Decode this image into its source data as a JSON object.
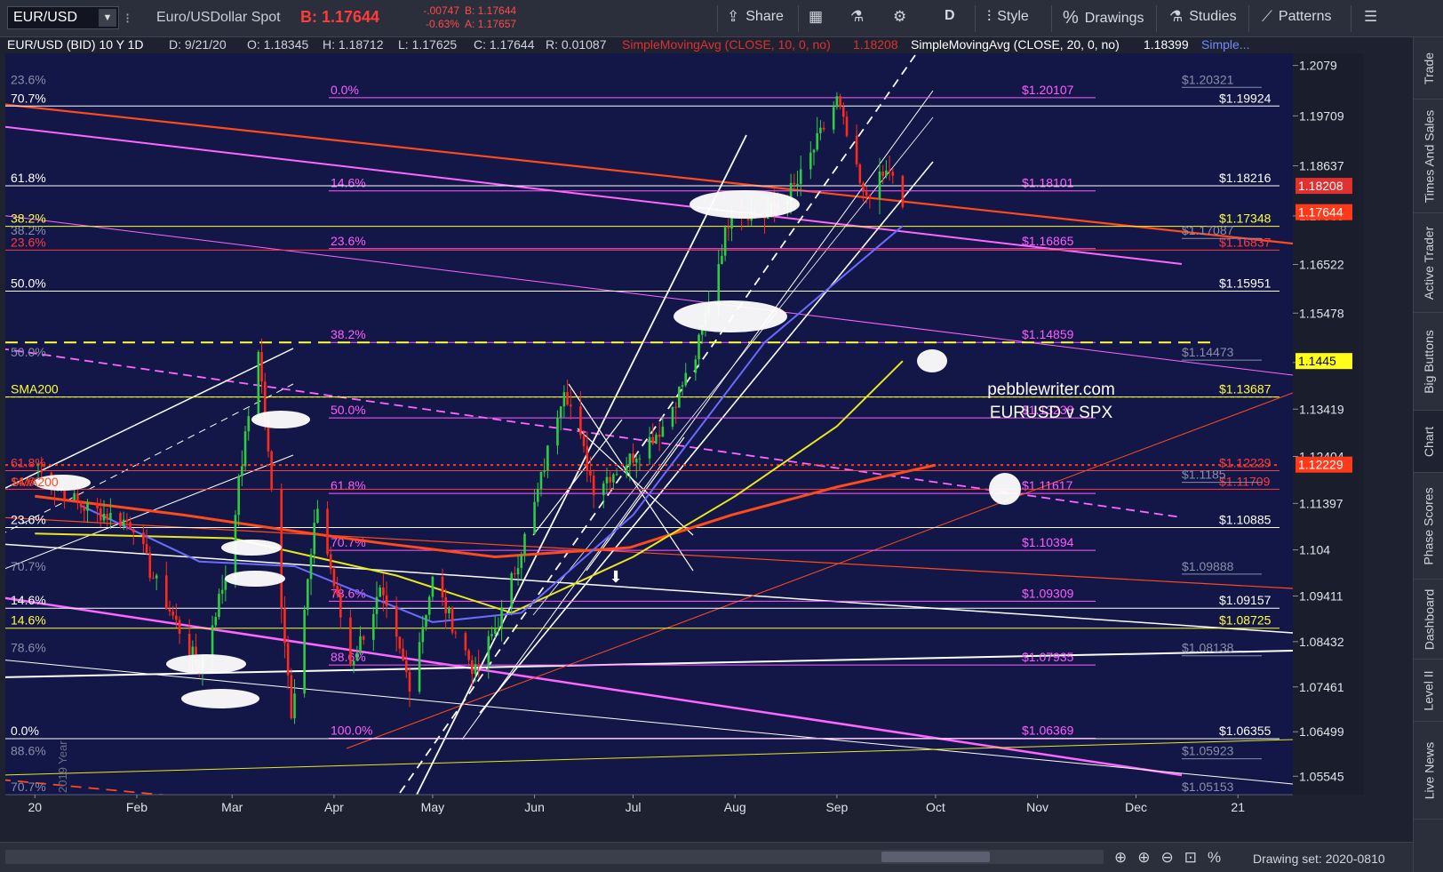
{
  "toolbar": {
    "symbol": "EUR/USD",
    "description": "Euro/USDollar Spot",
    "bid": "B: 1.17644",
    "change": "-.00747",
    "change_pct": "-0.63%",
    "bid_small": "B: 1.17644",
    "ask_small": "A: 1.17657",
    "share": "Share",
    "period": "D",
    "style": "Style",
    "drawings": "Drawings",
    "studies": "Studies",
    "patterns": "Patterns"
  },
  "header": {
    "symbol": "EUR/USD (BID) 10 Y 1D",
    "date": "D: 9/21/20",
    "open": "O: 1.18345",
    "high": "H: 1.18712",
    "low": "L: 1.17625",
    "close": "C: 1.17644",
    "range": "R: 0.01087",
    "sma10": "SimpleMovingAvg (CLOSE, 10, 0, no)",
    "sma10_val": "1.18208",
    "sma20": "SimpleMovingAvg (CLOSE, 20, 0, no)",
    "sma20_val": "1.18399",
    "sma_more": "Simple..."
  },
  "side_tabs": [
    "Trade",
    "Times And Sales",
    "Active Trader",
    "Big Buttons",
    "Chart",
    "Phase Scores",
    "Dashboard",
    "Level II",
    "Live News"
  ],
  "bottom": {
    "drawing_set": "Drawing set: 2020-0810"
  },
  "annotation": {
    "line1": "pebblewriter.com",
    "line2": "EURUSD v SPX"
  },
  "colors": {
    "background": "#131748",
    "price_up": "#2ecc40",
    "price_down": "#ff2a1a",
    "sma10": "#d81b1b",
    "sma20": "#ffffff",
    "sma50": "#6a6cff",
    "sma100": "#e8e81a",
    "sma200": "#ff4a1a",
    "fib": "#ff5cff"
  },
  "chart_data": {
    "type": "candlestick",
    "title": "EUR/USD (BID) 10 Y 1D",
    "x_ticks": [
      "20",
      "Feb",
      "Mar",
      "Apr",
      "May",
      "Jun",
      "Jul",
      "Aug",
      "Sep",
      "Oct",
      "Nov",
      "Dec",
      "21"
    ],
    "x_tick_dates": [
      "2020-01-01",
      "2020-02-01",
      "2020-03-01",
      "2020-04-01",
      "2020-05-01",
      "2020-06-01",
      "2020-07-01",
      "2020-08-01",
      "2020-09-01",
      "2020-10-01",
      "2020-11-01",
      "2020-12-01",
      "2021-01-01"
    ],
    "y_ticks": [
      "1.2079",
      "1.19709",
      "1.18637",
      "1.17563",
      "1.16522",
      "1.15478",
      "1.14419",
      "1.13419",
      "1.12404",
      "1.11397",
      "1.104",
      "1.09411",
      "1.08432",
      "1.07461",
      "1.06499",
      "1.05545"
    ],
    "ylim": [
      1.0515,
      1.2105
    ],
    "price_labels": [
      {
        "text": "1.18208",
        "value": 1.18208,
        "color": "#e03030"
      },
      {
        "text": "1.17644",
        "value": 1.17644,
        "color": "#ff3a1a"
      },
      {
        "text": "1.1445",
        "value": 1.1445,
        "color": "#ffff1a"
      },
      {
        "text": "1.12229",
        "value": 1.12229,
        "color": "#ff3a1a"
      }
    ],
    "series_points": [
      {
        "date": "2020-01-01",
        "close": 1.1215
      },
      {
        "date": "2020-01-15",
        "close": 1.1135
      },
      {
        "date": "2020-01-31",
        "close": 1.1095
      },
      {
        "date": "2020-02-05",
        "close": 1.0995
      },
      {
        "date": "2020-02-20",
        "close": 1.0785
      },
      {
        "date": "2020-02-28",
        "close": 1.0985
      },
      {
        "date": "2020-03-09",
        "close": 1.1475
      },
      {
        "date": "2020-03-19",
        "close": 1.0695
      },
      {
        "date": "2020-03-27",
        "close": 1.1135
      },
      {
        "date": "2020-04-06",
        "close": 1.0795
      },
      {
        "date": "2020-04-15",
        "close": 1.0945
      },
      {
        "date": "2020-04-24",
        "close": 1.0755
      },
      {
        "date": "2020-05-01",
        "close": 1.0975
      },
      {
        "date": "2020-05-14",
        "close": 1.0775
      },
      {
        "date": "2020-05-22",
        "close": 1.0905
      },
      {
        "date": "2020-06-01",
        "close": 1.1135
      },
      {
        "date": "2020-06-10",
        "close": 1.1395
      },
      {
        "date": "2020-06-19",
        "close": 1.1175
      },
      {
        "date": "2020-06-30",
        "close": 1.1235
      },
      {
        "date": "2020-07-10",
        "close": 1.1305
      },
      {
        "date": "2020-07-20",
        "close": 1.1455
      },
      {
        "date": "2020-07-31",
        "close": 1.1775
      },
      {
        "date": "2020-08-10",
        "close": 1.1755
      },
      {
        "date": "2020-08-20",
        "close": 1.1825
      },
      {
        "date": "2020-09-01",
        "close": 1.2005
      },
      {
        "date": "2020-09-09",
        "close": 1.1795
      },
      {
        "date": "2020-09-17",
        "close": 1.1855
      },
      {
        "date": "2020-09-21",
        "close": 1.1764
      }
    ],
    "sma200_points": [
      {
        "date": "2020-01-01",
        "value": 1.1155
      },
      {
        "date": "2020-02-15",
        "value": 1.1115
      },
      {
        "date": "2020-03-15",
        "value": 1.1085
      },
      {
        "date": "2020-04-15",
        "value": 1.1055
      },
      {
        "date": "2020-05-20",
        "value": 1.1025
      },
      {
        "date": "2020-06-30",
        "value": 1.1045
      },
      {
        "date": "2020-07-31",
        "value": 1.1115
      },
      {
        "date": "2020-09-01",
        "value": 1.1175
      },
      {
        "date": "2020-10-01",
        "value": 1.1222
      }
    ],
    "sma100_points": [
      {
        "date": "2020-01-01",
        "value": 1.1075
      },
      {
        "date": "2020-03-01",
        "value": 1.1065
      },
      {
        "date": "2020-04-20",
        "value": 1.0985
      },
      {
        "date": "2020-05-25",
        "value": 1.0905
      },
      {
        "date": "2020-07-01",
        "value": 1.1025
      },
      {
        "date": "2020-08-01",
        "value": 1.1155
      },
      {
        "date": "2020-09-01",
        "value": 1.1305
      },
      {
        "date": "2020-09-21",
        "value": 1.1445
      }
    ],
    "sma50_points": [
      {
        "date": "2020-01-15",
        "value": 1.1135
      },
      {
        "date": "2020-02-20",
        "value": 1.1015
      },
      {
        "date": "2020-03-20",
        "value": 1.1005
      },
      {
        "date": "2020-05-01",
        "value": 1.0885
      },
      {
        "date": "2020-05-28",
        "value": 1.0905
      },
      {
        "date": "2020-07-01",
        "value": 1.1115
      },
      {
        "date": "2020-08-10",
        "value": 1.1485
      },
      {
        "date": "2020-09-21",
        "value": 1.1735
      }
    ],
    "fib_levels": [
      {
        "text": "0.0%",
        "value": 1.201,
        "price": "$1.20107"
      },
      {
        "text": "14.6%",
        "value": 1.181,
        "price": "$1.18101"
      },
      {
        "text": "23.6%",
        "value": 1.1686,
        "price": "$1.16865"
      },
      {
        "text": "38.2%",
        "value": 1.1485,
        "price": "$1.14859"
      },
      {
        "text": "50.0%",
        "value": 1.1323,
        "price": "$1.13238"
      },
      {
        "text": "61.8%",
        "value": 1.1161,
        "price": "$1.11617"
      },
      {
        "text": "70.7%",
        "value": 1.1039,
        "price": "$1.10394"
      },
      {
        "text": "78.6%",
        "value": 1.093,
        "price": "$1.09309"
      },
      {
        "text": "88.6%",
        "value": 1.0793,
        "price": "$1.07935"
      },
      {
        "text": "100.0%",
        "value": 1.0636,
        "price": "$1.06369"
      }
    ],
    "white_levels": [
      {
        "text": "70.7%",
        "value": 1.1992,
        "price": "$1.19924"
      },
      {
        "text": "61.8%",
        "value": 1.1821,
        "price": "$1.18216"
      },
      {
        "text": "50.0%",
        "value": 1.1595,
        "price": "$1.15951"
      },
      {
        "text": "23.6%",
        "value": 1.1088,
        "price": "$1.10885"
      },
      {
        "text": "14.6%",
        "value": 1.0915,
        "price": "$1.09157"
      },
      {
        "text": "0.0%",
        "value": 1.0635,
        "price": "$1.06355"
      }
    ],
    "yellow_levels": [
      {
        "text": "38.2%",
        "value": 1.1734,
        "price": "$1.17348"
      },
      {
        "text": "14.6%",
        "value": 1.0872,
        "price": "$1.08725"
      },
      {
        "text": "SMA200",
        "value": 1.1368,
        "price": "$1.13687"
      }
    ],
    "red_levels": [
      {
        "text": "23.6%",
        "value": 1.1683,
        "price": "$1.16837"
      },
      {
        "text": "61.8%",
        "value": 1.121,
        "price": "$1.12229"
      },
      {
        "text": "14.6%",
        "value": 1.117,
        "price": "$1.11709"
      }
    ],
    "gray_levels": [
      {
        "text": "23.6%",
        "value": 1.2032,
        "price": "$1.20321"
      },
      {
        "text": "38.2%",
        "value": 1.1708,
        "price": "$1.17087"
      },
      {
        "text": "50.0%",
        "value": 1.1447,
        "price": "$1.14473"
      },
      {
        "text": "70.7%",
        "value": 1.0988,
        "price": "$1.09888"
      },
      {
        "text": "78.6%",
        "value": 1.0813,
        "price": "$1.08138"
      },
      {
        "text": "88.6%",
        "value": 1.0592,
        "price": "$1.05923"
      },
      {
        "text": "70.7%",
        "value": 1.0515,
        "price": "$1.05153"
      },
      {
        "text": "",
        "value": 1.1185,
        "price": "$1.1185"
      }
    ],
    "left_labels": [
      "SMA200",
      "2019 Year",
      "2020"
    ]
  }
}
